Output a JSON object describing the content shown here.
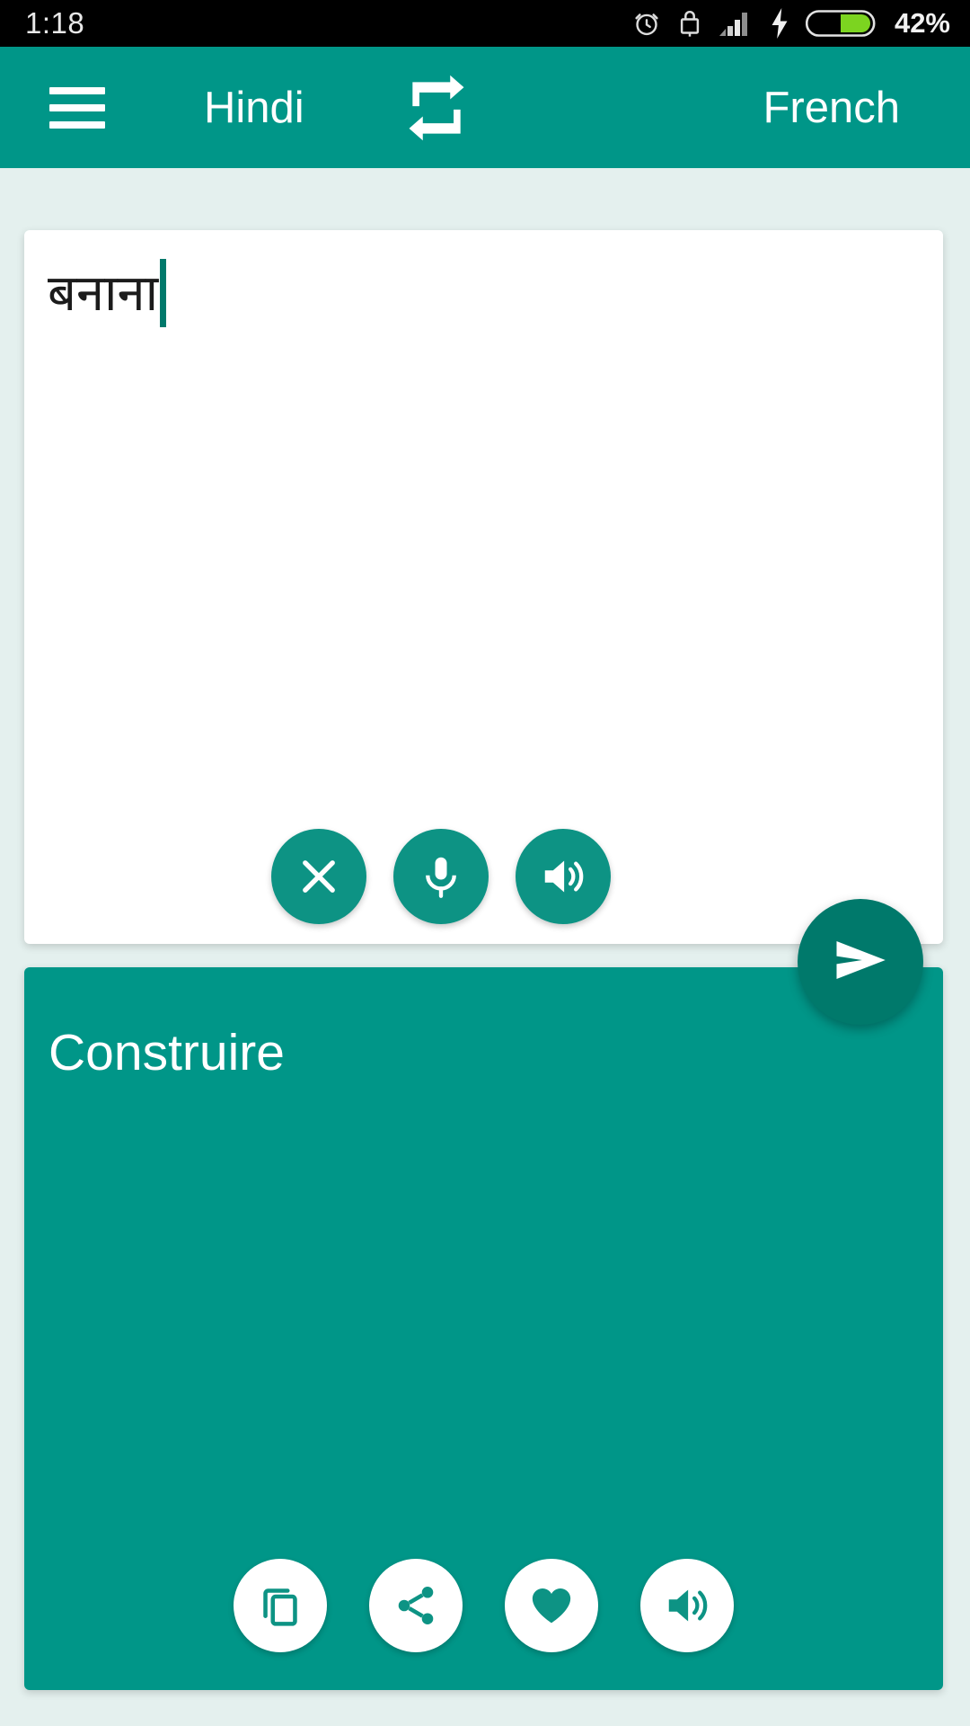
{
  "status_bar": {
    "time": "1:18",
    "battery_percent": "42%",
    "icons": [
      "alarm-icon",
      "lock-icon",
      "signal-icon",
      "charging-bolt-icon",
      "battery-icon"
    ]
  },
  "app_bar": {
    "menu_icon": "hamburger-menu-icon",
    "source_language": "Hindi",
    "swap_icon": "swap-languages-icon",
    "target_language": "French"
  },
  "input_card": {
    "text": "बनाना",
    "placeholder": "",
    "actions": [
      {
        "name": "clear",
        "icon": "close-icon"
      },
      {
        "name": "voice",
        "icon": "microphone-icon"
      },
      {
        "name": "speak",
        "icon": "speaker-icon"
      }
    ]
  },
  "send_button": {
    "label": "send",
    "icon": "send-icon"
  },
  "output_card": {
    "text": "Construire",
    "actions": [
      {
        "name": "copy",
        "icon": "copy-icon"
      },
      {
        "name": "share",
        "icon": "share-icon"
      },
      {
        "name": "favorite",
        "icon": "heart-icon"
      },
      {
        "name": "speak",
        "icon": "speaker-icon"
      }
    ]
  },
  "colors": {
    "primary_teal": "#009688",
    "dark_teal": "#00796b",
    "button_teal": "#0d9384",
    "background": "#e4f0ee",
    "card_white": "#ffffff",
    "status_bar": "#000000",
    "battery_green": "#7cd420"
  }
}
